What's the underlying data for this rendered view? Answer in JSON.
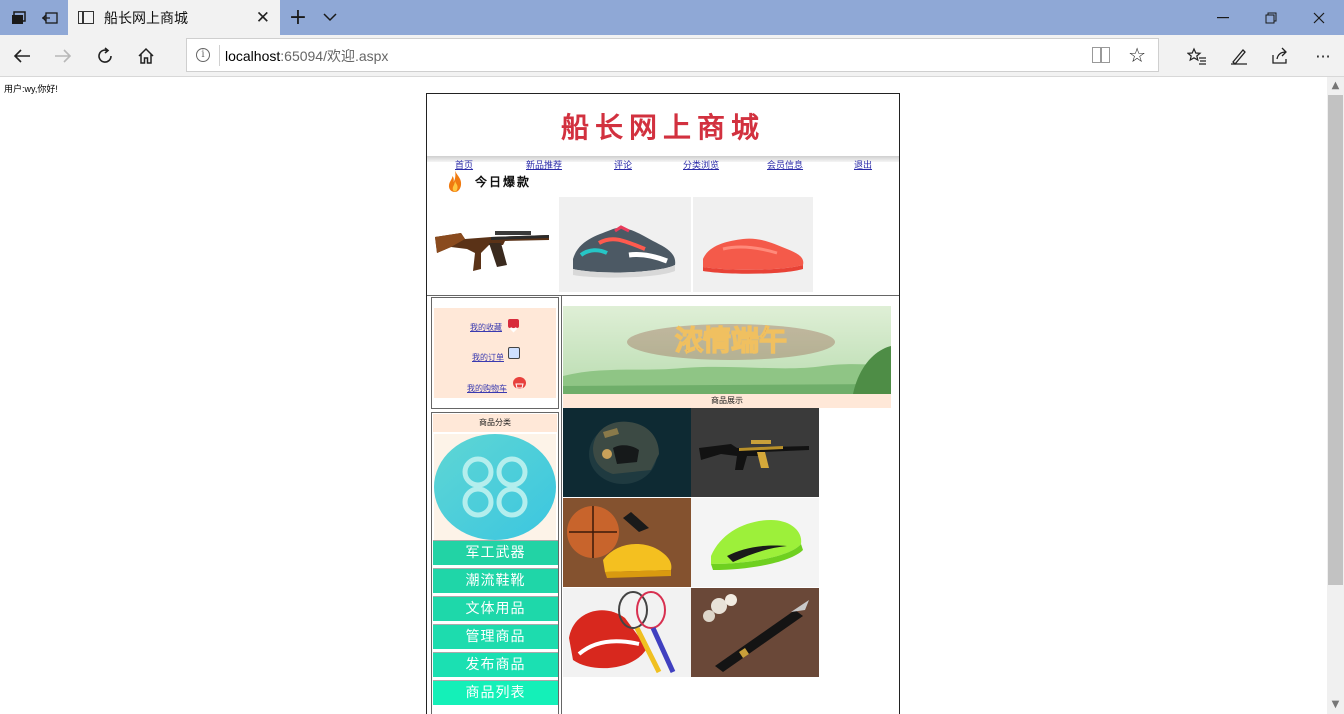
{
  "browser": {
    "tab_title": "船长网上商城",
    "url_host": "localhost",
    "url_rest": ":65094/欢迎.aspx"
  },
  "page": {
    "greeting": "用户:wy,你好!",
    "site_logo": "船长网上商城",
    "top_nav": [
      "首页",
      "新品推荐",
      "评论",
      "分类浏览",
      "会员信息",
      "退出"
    ],
    "hot_title": "今日爆款",
    "hot_items": [
      "rifle-product",
      "sneaker-multicolor-product",
      "sneaker-coral-product"
    ],
    "side_links": {
      "favorites": "我的收藏",
      "orders": "我的订单",
      "cart": "我的购物车"
    },
    "category_header": "商品分类",
    "categories": [
      "军工武器",
      "潮流鞋靴",
      "文体用品",
      "管理商品",
      "发布商品",
      "商品列表"
    ],
    "promo_banner_text": "浓情端午",
    "showcase_caption": "商品展示",
    "showcase_items": [
      "helmet",
      "rifle-black",
      "basketball-shoe",
      "neon-sneaker",
      "badminton-rackets",
      "fountain-pen"
    ]
  },
  "colors": {
    "chrome_tab_bar": "#8fa8d6",
    "logo_red": "#d2313f",
    "link_blue": "#2a2aa8",
    "peach_panel": "#ffe8d8",
    "category_teal": "#22d3a5"
  }
}
